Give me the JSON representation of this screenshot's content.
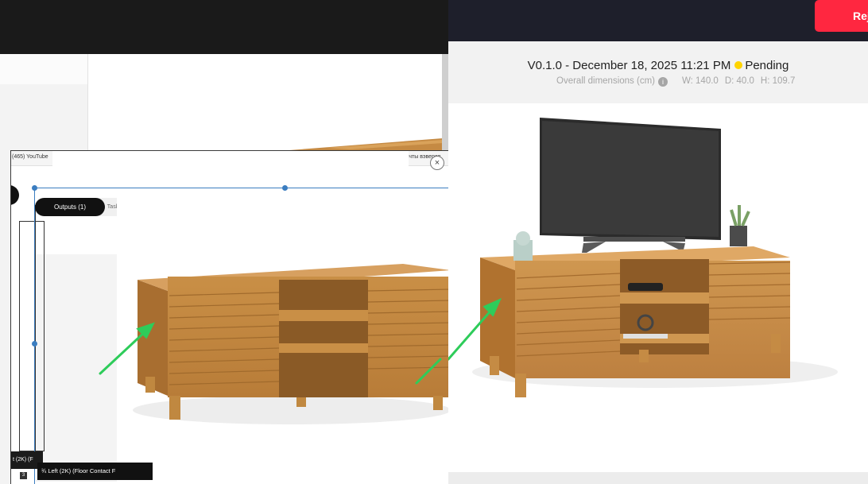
{
  "overlay": {
    "tab_left": "(465) YouTube",
    "tab_right": "счты вэверов",
    "close_icon": "×",
    "outputs_label": "Outputs (1)",
    "task_label": "Task",
    "side_label": "t (2K) (F",
    "caption": "¾ Left (2K) (Floor Contact F",
    "mini_number": "3"
  },
  "version": {
    "title": "V0.1.0 - December 18, 2025 11:21 PM",
    "status": "Pending",
    "status_color": "#ffd400"
  },
  "dimensions": {
    "label": "Overall dimensions (cm)",
    "info_icon": "i",
    "width": "W: 140.0",
    "depth": "D: 40.0",
    "height": "H: 109.7"
  },
  "header": {
    "reject_label": "Rej",
    "accent": "#ff2740"
  },
  "arrow_color": "#2ecc5a"
}
